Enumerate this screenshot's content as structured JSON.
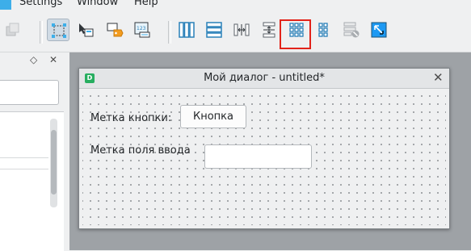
{
  "menubar": {
    "items": [
      {
        "label": "Settings"
      },
      {
        "label": "Window"
      },
      {
        "label": "Help"
      }
    ]
  },
  "toolbar": {
    "highlight_color": "#e2231a",
    "buttons": [
      {
        "icon": "raise-widget-icon",
        "state": "disabled"
      },
      {
        "icon": "edit-widgets-icon",
        "state": "active"
      },
      {
        "icon": "edit-signals-slots-icon",
        "state": "normal"
      },
      {
        "icon": "edit-buddies-icon",
        "state": "normal"
      },
      {
        "icon": "edit-tab-order-icon",
        "state": "normal"
      },
      {
        "icon": "layout-horizontally-icon",
        "state": "normal"
      },
      {
        "icon": "layout-vertically-icon",
        "state": "normal"
      },
      {
        "icon": "layout-horizontal-splitter-icon",
        "state": "normal"
      },
      {
        "icon": "layout-vertical-splitter-icon",
        "state": "normal"
      },
      {
        "icon": "layout-grid-icon",
        "state": "highlighted"
      },
      {
        "icon": "layout-form-icon",
        "state": "normal"
      },
      {
        "icon": "break-layout-icon",
        "state": "disabled"
      },
      {
        "icon": "adjust-size-icon",
        "state": "normal"
      }
    ]
  },
  "dock": {
    "float_icon": "◇",
    "close_icon": "✕"
  },
  "dialog": {
    "title": "Мой диалог - untitled*",
    "icon_letter": "D",
    "close_glyph": "✕",
    "label_button": "Метка кнопки:",
    "button_text": "Кнопка",
    "label_field": "Метка поля ввода",
    "field_value": ""
  }
}
